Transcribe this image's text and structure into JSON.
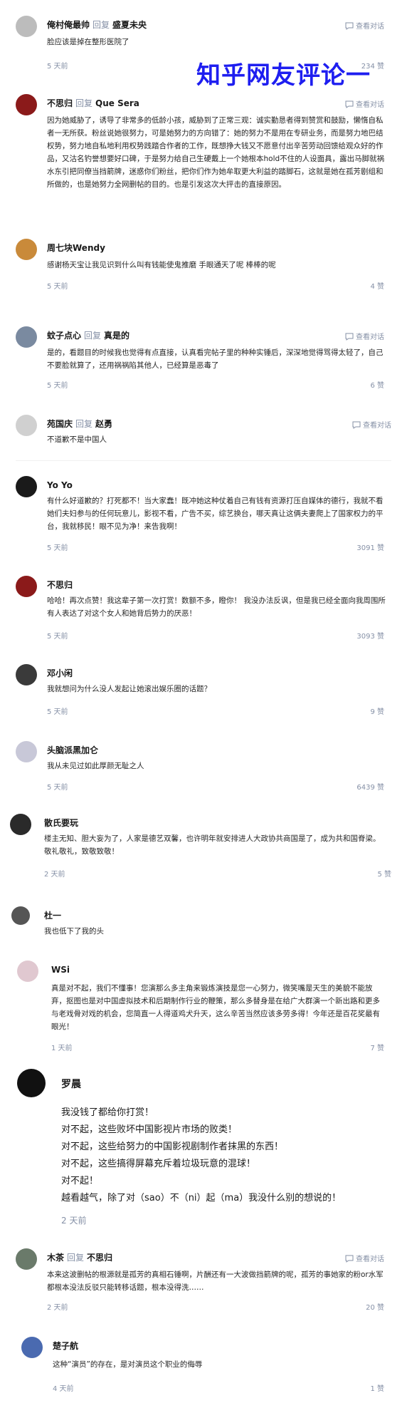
{
  "overlay_title": "知乎网友评论一",
  "view_conversation_label": "查看对话",
  "reply_word": "回复",
  "comments": [
    {
      "author": "俺村俺最帅",
      "reply_to": "盛夏未央",
      "has_conversation": true,
      "text": "脸应该是掉在整形医院了",
      "time": "5 天前",
      "likes": "234 赞",
      "avatar_color": "#bcbcbc"
    },
    {
      "author": "不思归",
      "reply_to": "Que Sera",
      "has_conversation": true,
      "text": "因为她威胁了，诱导了非常多的低龄小孩，威胁到了正常三观：诚实勤恳者得到赞赏和鼓励，懒惰自私者一无所获。粉丝说她很努力，可是她努力的方向错了：她的努力不是用在专研业务，而是努力地巴结权势，努力地自私地利用权势践踏合作者的工作，既想挣大钱又不愿意付出辛苦劳动回馈给观众好的作品，又沽名钓誉想要好口碑，于是努力给自己生硬戴上一个她根本hold不住的人设面具，露出马脚就祸水东引把同僚当挡箭牌，迷惑你们粉丝，把你们作为她牟取更大利益的踏脚石，这就是她在孤芳剧组和所做的，也是她努力全网删帖的目的。也是引发这次大抨击的直接原因。",
      "time": "",
      "likes": "",
      "avatar_color": "#8b1a1a"
    },
    {
      "author": "周七块Wendy",
      "reply_to": "",
      "has_conversation": false,
      "text": "感谢杨天宝让我见识到什么叫有钱能使鬼推磨 手眼通天了呢 棒棒的呢",
      "time": "5 天前",
      "likes": "4 赞",
      "avatar_color": "#c98a3a"
    },
    {
      "author": "蚊子点心",
      "reply_to": "真是的",
      "has_conversation": true,
      "text": "是的，看题目的时候我也觉得有点直接，认真看完帖子里的种种实锤后，深深地觉得骂得太轻了，自己不要脸就算了，还用祸祸陷其他人，已经算是恶毒了",
      "time": "5 天前",
      "likes": "6 赞",
      "avatar_color": "#7a8aa0"
    },
    {
      "author": "苑国庆",
      "reply_to": "赵勇",
      "has_conversation": true,
      "text": "不道歉不是中国人",
      "time": "",
      "likes": "",
      "avatar_color": "#d0d0d0"
    },
    {
      "author": "Yo Yo",
      "reply_to": "",
      "has_conversation": false,
      "text": "有什么好道歉的？打死都不！当大家蠢！既冲她这种仗着自己有钱有资源打压自媒体的德行，我就不看她们夫妇参与的任何玩意儿，影视不看，广告不买，综艺换台，哪天真让这俩夫妻爬上了国家权力的平台，我就移民！眼不见为净！来告我啊！",
      "time": "5 天前",
      "likes": "3091 赞",
      "avatar_color": "#1a1a1a"
    },
    {
      "author": "不思归",
      "reply_to": "",
      "has_conversation": false,
      "text": "哈哈！再次点赞！我这辈子第一次打赏！数额不多，瞪你！ 我没办法反讽，但是我已经全面向我周围所有人表达了对这个女人和她背后势力的厌恶！",
      "time": "5 天前",
      "likes": "3093 赞",
      "avatar_color": "#8b1a1a"
    },
    {
      "author": "邓小闲",
      "reply_to": "",
      "has_conversation": false,
      "text": "我就想问为什么没人发起让她滚出娱乐圈的话题？",
      "time": "5 天前",
      "likes": "9 赞",
      "avatar_color": "#3a3a3a"
    },
    {
      "author": "头脑派黑加仑",
      "reply_to": "",
      "has_conversation": false,
      "text": "我从未见过如此厚颜无耻之人",
      "time": "5 天前",
      "likes": "6439 赞",
      "avatar_color": "#c8c8d8"
    },
    {
      "author": "散氏要玩",
      "reply_to": "",
      "has_conversation": false,
      "text": "楼主无知、胆大妄为了，人家是德艺双馨，也许明年就安排进人大政协共商国是了，成为共和国脊梁。敬礼敬礼，致敬致敬！",
      "time": "2 天前",
      "likes": "5 赞",
      "avatar_color": "#2a2a2a"
    },
    {
      "author": "杜一",
      "reply_to": "",
      "has_conversation": false,
      "text": "我也低下了我的头",
      "time": "",
      "likes": "",
      "avatar_color": "#555555"
    },
    {
      "author": "WSi",
      "reply_to": "",
      "has_conversation": false,
      "text": "真是对不起，我们不懂事！您演那么多主角来锻炼演技是您一心努力，微笑嘴是天生的美貌不能放弃，抠图也是对中国虚拟技术和后期制作行业的鞭策，那么多替身是在给广大群演一个新出路和更多与老戏骨对戏的机会，您简直一人得道鸡犬升天，这么辛苦当然应该多劳多得！今年还是百花奖最有眼光！",
      "time": "1 天前",
      "likes": "7 赞",
      "avatar_color": "#e0c8d0"
    },
    {
      "author": "罗晨",
      "reply_to": "",
      "has_conversation": false,
      "lines": [
        "我没钱了都给你打赏！",
        "对不起，这些败坏中国影视片市场的败类！",
        "对不起，这些给努力的中国影视剧制作者抹黑的东西！",
        "对不起，这些搞得屏幕充斥着垃圾玩意的混球！",
        "对不起！",
        "越看越气，除了对（sao）不（ni）起（ma）我没什么别的想说的！"
      ],
      "time": "2 天前",
      "likes": "",
      "avatar_color": "#111111"
    },
    {
      "author": "木茶",
      "reply_to": "不思归",
      "has_conversation": true,
      "text": "本来这波删帖的根源就是孤芳的真相石锤啊，片酬还有一大波做挡箭牌的呢，孤芳的事她家的粉or水军都根本没法反驳只能转移话题，根本没得洗……",
      "time": "2 天前",
      "likes": "20 赞",
      "avatar_color": "#6a7a6a"
    },
    {
      "author": "楚子航",
      "reply_to": "",
      "has_conversation": false,
      "text": "这种“演员”的存在，是对演员这个职业的侮辱",
      "time": "4 天前",
      "likes": "1 赞",
      "avatar_color": "#4a6ab0"
    }
  ]
}
